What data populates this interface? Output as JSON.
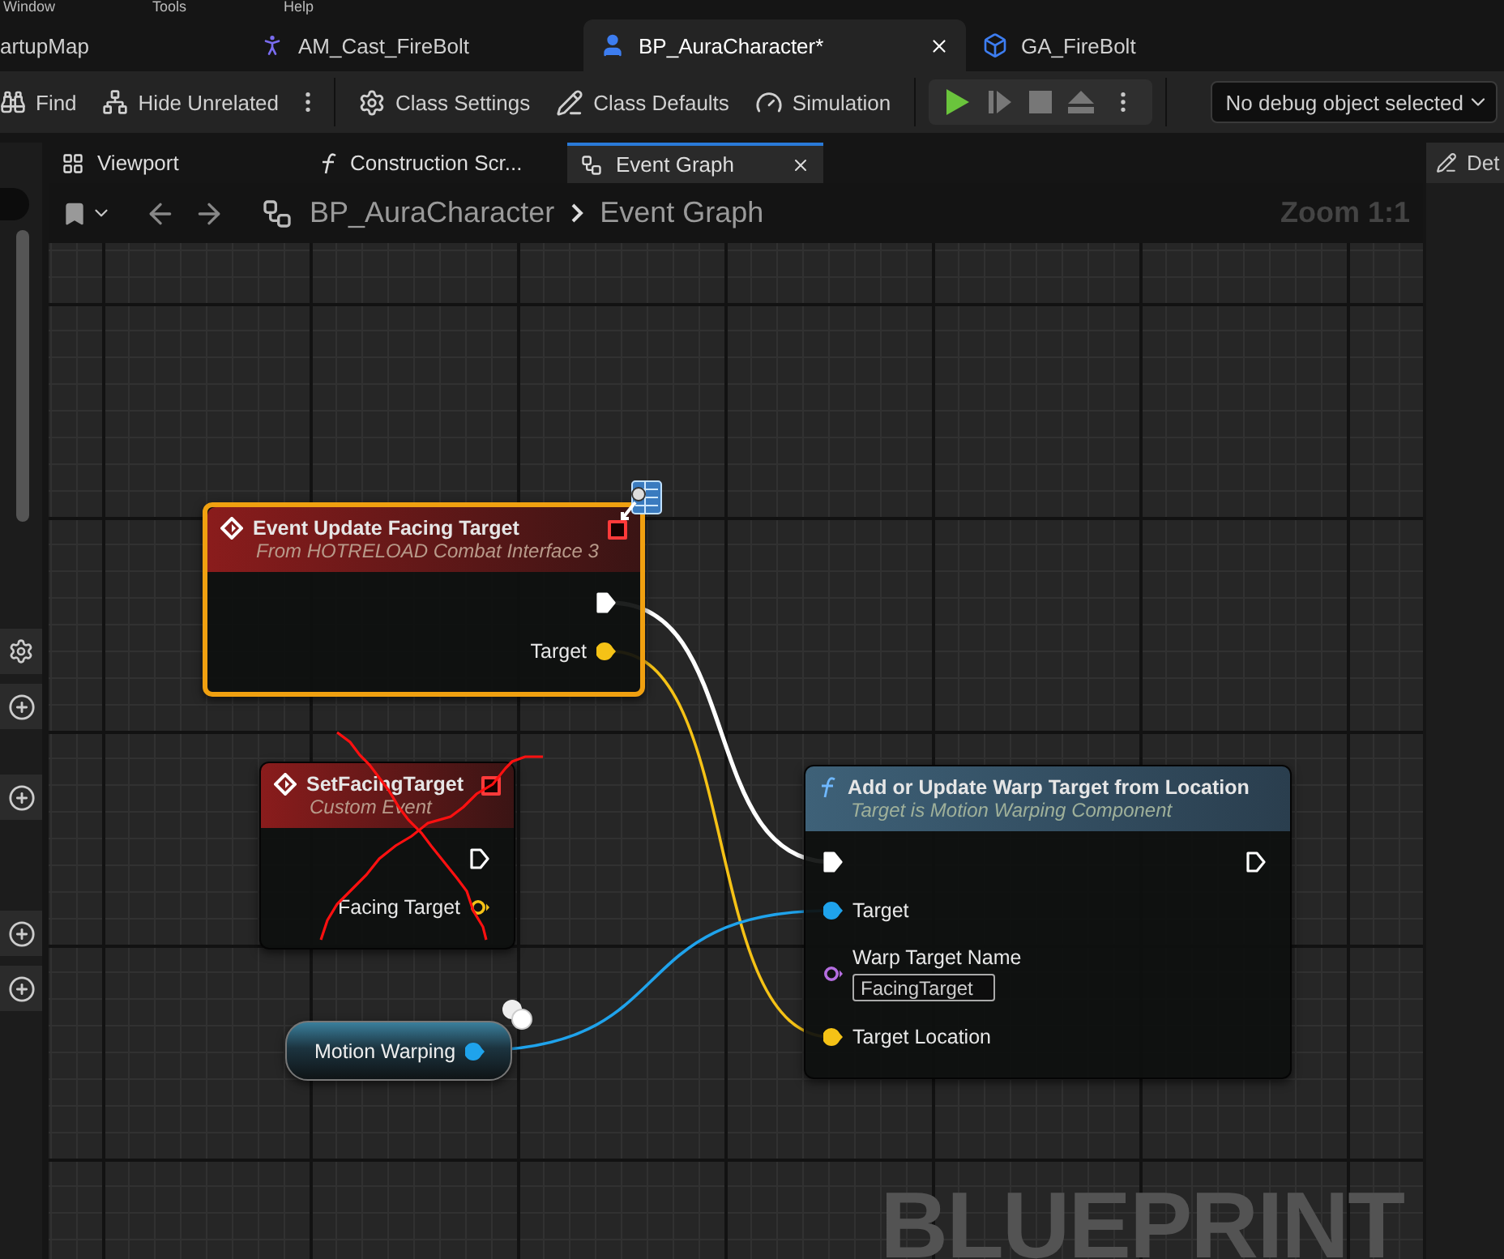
{
  "menu": [
    {
      "label": "Window"
    },
    {
      "label": "Tools"
    },
    {
      "label": "Help"
    }
  ],
  "document_tabs": [
    {
      "label": "artupMap",
      "selected": false
    },
    {
      "label": "AM_Cast_FireBolt",
      "selected": false
    },
    {
      "label": "BP_AuraCharacter*",
      "selected": true
    },
    {
      "label": "GA_FireBolt",
      "selected": false
    }
  ],
  "toolbar": {
    "left": [
      {
        "label": "Find"
      },
      {
        "label": "Hide Unrelated"
      }
    ],
    "middle": [
      {
        "label": "Class Settings"
      },
      {
        "label": "Class Defaults"
      },
      {
        "label": "Simulation"
      }
    ],
    "debug_dropdown": "No debug object selected"
  },
  "graph_tabs": [
    {
      "label": "Viewport",
      "selected": false
    },
    {
      "label": "Construction Scr...",
      "selected": false
    },
    {
      "label": "Event Graph",
      "selected": true
    }
  ],
  "breadcrumb": [
    "BP_AuraCharacter",
    "Event Graph"
  ],
  "zoom": "Zoom 1:1",
  "details_tab": "Det",
  "graph": {
    "nodes": [
      {
        "kind": "event",
        "title": "Event Update Facing Target",
        "subtitle": "From HOTRELOAD Combat Interface 3",
        "selected": true,
        "rows": [
          {
            "right": {
              "kind": "exec",
              "connected": true
            }
          },
          {
            "right": {
              "kind": "vector",
              "label": "Target",
              "connected": true
            }
          }
        ]
      },
      {
        "kind": "custom_event",
        "title": "SetFacingTarget",
        "subtitle": "Custom Event",
        "selected": false,
        "rows": [
          {
            "right": {
              "kind": "exec",
              "connected": false
            }
          },
          {
            "right": {
              "kind": "vector",
              "label": "Facing Target",
              "connected": false
            }
          }
        ]
      },
      {
        "kind": "function",
        "title": "Add or Update Warp Target from Location",
        "subtitle": "Target is Motion Warping Component",
        "selected": false,
        "rows": [
          {
            "left": {
              "kind": "exec",
              "connected": true
            },
            "right": {
              "kind": "exec",
              "connected": false
            }
          },
          {
            "left": {
              "kind": "object",
              "label": "Target",
              "connected": true
            }
          },
          {
            "left": {
              "kind": "name",
              "label": "Warp Target Name",
              "value": "FacingTarget",
              "connected": false
            }
          },
          {
            "left": {
              "kind": "vector",
              "label": "Target Location",
              "connected": true
            }
          }
        ]
      },
      {
        "kind": "variable",
        "title": "Motion Warping",
        "selected": false,
        "rows": [
          {
            "right": {
              "kind": "object",
              "connected": true
            }
          }
        ]
      }
    ],
    "annotation": {
      "kind": "cross"
    },
    "corner_label": "BLUEPRINT"
  }
}
